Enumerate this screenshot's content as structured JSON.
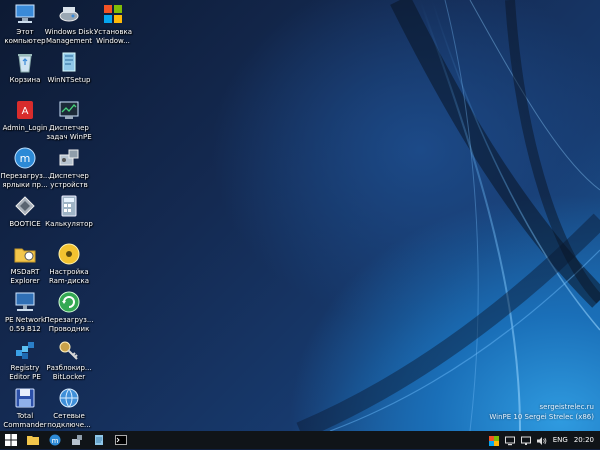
{
  "desktop": {
    "icons": [
      {
        "label": "Этот\nкомпьютер",
        "icon": "computer-icon"
      },
      {
        "label": "Windows Disk\nManagement",
        "icon": "disk-management-icon"
      },
      {
        "label": "Установка\nWindow...",
        "icon": "windows-setup-icon"
      },
      {
        "label": "Корзина",
        "icon": "recycle-bin-icon"
      },
      {
        "label": "WinNTSetup",
        "icon": "winntsetup-icon"
      },
      {
        "label": "Admin_Login",
        "icon": "admin-login-icon"
      },
      {
        "label": "Диспетчер\nзадач WinPE",
        "icon": "task-manager-icon"
      },
      {
        "label": "Перезагруз...\nярлыки пр...",
        "icon": "reload-shortcuts-icon"
      },
      {
        "label": "Диспетчер\nустройств",
        "icon": "device-manager-icon"
      },
      {
        "label": "BOOTICE",
        "icon": "bootice-icon"
      },
      {
        "label": "Калькулятор",
        "icon": "calculator-icon"
      },
      {
        "label": "MSDaRT\nExplorer",
        "icon": "msdart-explorer-icon"
      },
      {
        "label": "Настройка\nRam-диска",
        "icon": "ramdisk-icon"
      },
      {
        "label": "PE Network\n0.59.B12",
        "icon": "pe-network-icon"
      },
      {
        "label": "Перезагруз...\nПроводник",
        "icon": "restart-explorer-icon"
      },
      {
        "label": "Registry\nEditor PE",
        "icon": "registry-editor-icon"
      },
      {
        "label": "Разблокир...\nBitLocker",
        "icon": "bitlocker-unlock-icon"
      },
      {
        "label": "Total\nCommander",
        "icon": "total-commander-icon"
      },
      {
        "label": "Сетевые\nподключе...",
        "icon": "network-connections-icon"
      }
    ]
  },
  "watermark": {
    "line1": "sergeistrelec.ru",
    "line2": "WinPE 10 Sergei Strelec (x86)"
  },
  "taskbar": {
    "buttons": [
      {
        "icon": "start-windows-icon"
      },
      {
        "icon": "file-explorer-icon"
      },
      {
        "icon": "reload-app-icon"
      },
      {
        "icon": "tools-icon"
      },
      {
        "icon": "notepad-icon"
      },
      {
        "icon": "command-prompt-icon"
      }
    ],
    "tray": {
      "language": "ENG",
      "time": "20:20",
      "icons": [
        "color-app-icon",
        "monitor-icon",
        "network-tray-icon",
        "volume-icon"
      ]
    }
  },
  "colors": {
    "accent": "#1e7bd0",
    "taskbar_bg": "#101418"
  }
}
